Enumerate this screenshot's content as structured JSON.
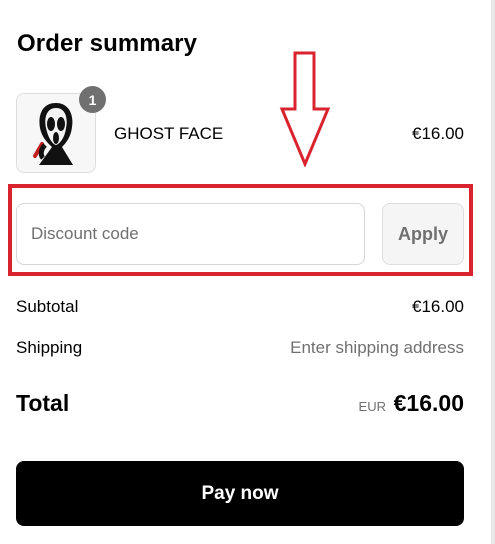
{
  "summary": {
    "title": "Order summary"
  },
  "product": {
    "quantity": "1",
    "name": "GHOST FACE",
    "price": "€16.00",
    "image_icon": "ghost-face-figure-icon"
  },
  "discount": {
    "placeholder": "Discount code",
    "value": "",
    "apply_label": "Apply"
  },
  "totals": {
    "subtotal_label": "Subtotal",
    "subtotal_value": "€16.00",
    "shipping_label": "Shipping",
    "shipping_value": "Enter shipping address",
    "total_label": "Total",
    "currency": "EUR",
    "total_value": "€16.00"
  },
  "actions": {
    "pay_label": "Pay now"
  },
  "colors": {
    "annotation": "#d9232e",
    "button": "#000000",
    "muted_text": "#707070"
  }
}
